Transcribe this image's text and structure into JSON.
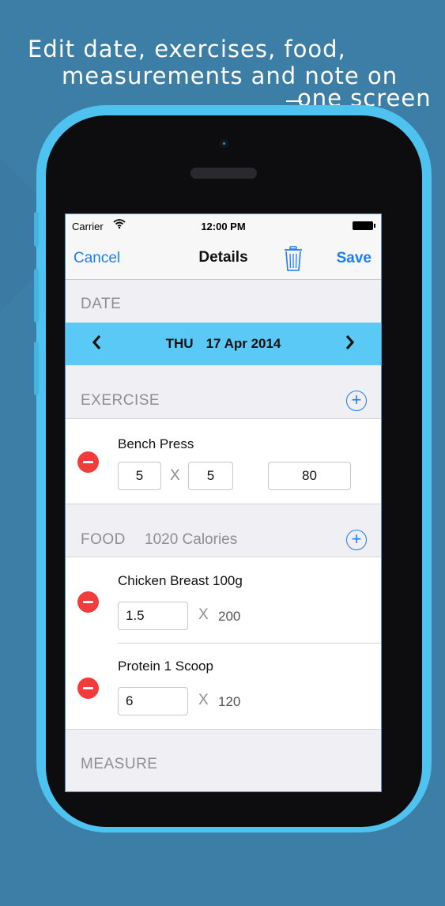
{
  "headline": {
    "line1": "Edit date, exercises, food,",
    "line2": "measurements and note on",
    "line3": "one screen"
  },
  "status_bar": {
    "carrier": "Carrier",
    "wifi_icon": "wifi-icon",
    "time": "12:00 PM",
    "battery_icon": "battery-icon"
  },
  "nav": {
    "cancel_label": "Cancel",
    "title": "Details",
    "trash_icon": "trash-icon",
    "save_label": "Save",
    "accent_color": "#1a7ff5"
  },
  "date_section": {
    "header": "DATE",
    "prev_icon": "‹",
    "next_icon": "›",
    "day": "THU",
    "date": "17 Apr 2014",
    "bar_color": "#5bc9f5"
  },
  "exercise_section": {
    "header": "EXERCISE",
    "add_icon": "+",
    "items": [
      {
        "name": "Bench Press",
        "sets": "5",
        "times_label": "X",
        "reps": "5",
        "weight": "80"
      }
    ]
  },
  "food_section": {
    "header": "FOOD",
    "calories": "1020 Calories",
    "add_icon": "+",
    "items": [
      {
        "name": "Chicken Breast 100g",
        "quantity": "1.5",
        "times_label": "X",
        "calories": "200"
      },
      {
        "name": "Protein 1 Scoop",
        "quantity": "6",
        "times_label": "X",
        "calories": "120"
      }
    ]
  },
  "measure_section": {
    "header": "MEASURE"
  },
  "colors": {
    "delete_red": "#f23b3b",
    "background": "#3d7ea6",
    "phone_body": "#4fc3ef"
  }
}
